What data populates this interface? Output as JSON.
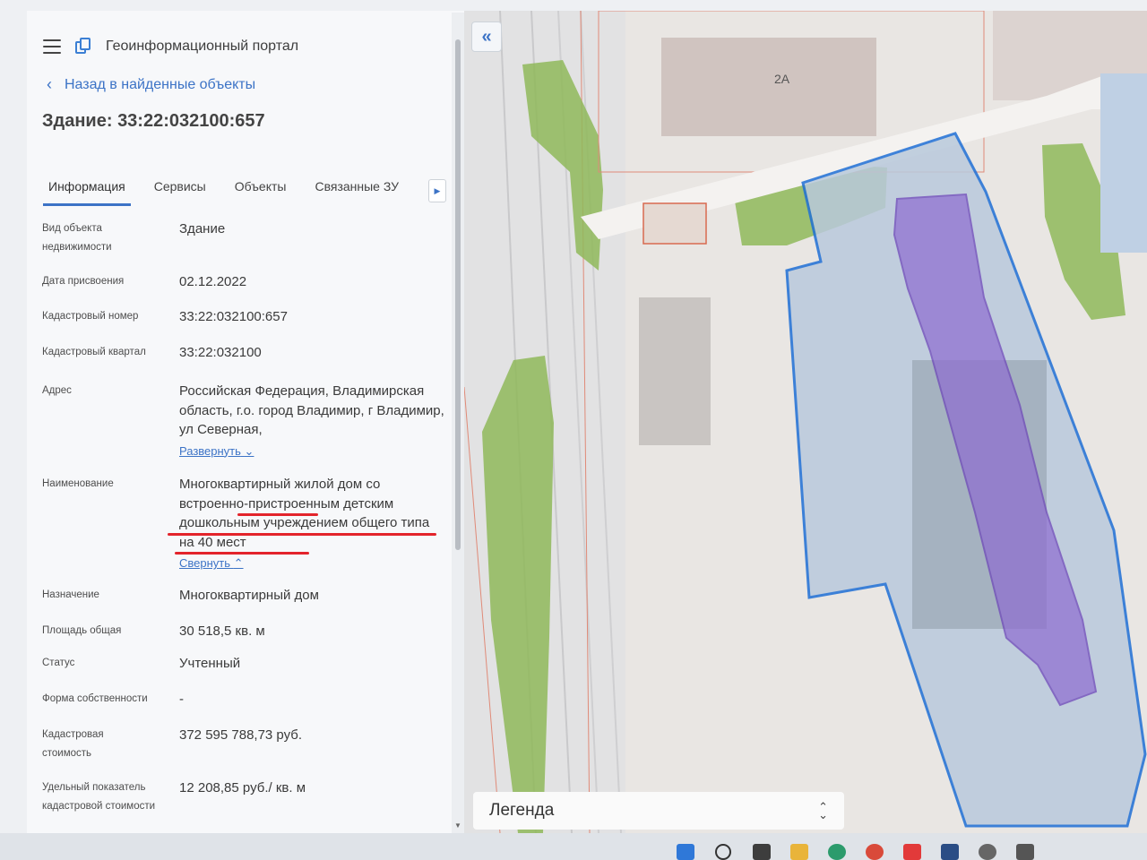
{
  "header": {
    "app_title": "Геоинформационный портал"
  },
  "nav": {
    "back_label": "Назад в найденные объекты"
  },
  "object": {
    "title": "Здание: 33:22:032100:657"
  },
  "tabs": [
    {
      "label": "Информация",
      "active": true
    },
    {
      "label": "Сервисы"
    },
    {
      "label": "Объекты"
    },
    {
      "label": "Связанные ЗУ"
    }
  ],
  "fields": {
    "type": {
      "label": "Вид объекта недвижимости",
      "value": "Здание"
    },
    "date": {
      "label": "Дата присвоения",
      "value": "02.12.2022"
    },
    "cadnum": {
      "label": "Кадастровый номер",
      "value": "33:22:032100:657"
    },
    "quarter": {
      "label": "Кадастровый квартал",
      "value": "33:22:032100"
    },
    "address": {
      "label": "Адрес",
      "value": "Российская Федерация, Владимирская область, г.о. город Владимир, г Владимир, ул Северная,",
      "expand_label": "Развернуть"
    },
    "name": {
      "label": "Наименование",
      "value": "Многоквартирный жилой дом со встроенно-пристроенным детским дошкольным учреждением общего типа на 40 мест",
      "collapse_label": "Свернуть"
    },
    "purpose": {
      "label": "Назначение",
      "value": "Многоквартирный дом"
    },
    "area": {
      "label": "Площадь общая",
      "value": "30 518,5 кв. м"
    },
    "status": {
      "label": "Статус",
      "value": "Учтенный"
    },
    "ownership": {
      "label": "Форма собственности",
      "value": "-"
    },
    "cost": {
      "label": "Кадастровая стоимость",
      "value": "372 595 788,73 руб."
    },
    "unit_cost": {
      "label": "Удельный показатель кадастровой стоимости",
      "value": "12 208,85 руб./ кв. м"
    }
  },
  "map": {
    "legend_label": "Легенда",
    "building_label": "2А"
  },
  "colors": {
    "accent": "#3c73c6",
    "highlight": "#e3242b",
    "parcel": "#1f6fd6",
    "building": "#8e6bd1"
  }
}
